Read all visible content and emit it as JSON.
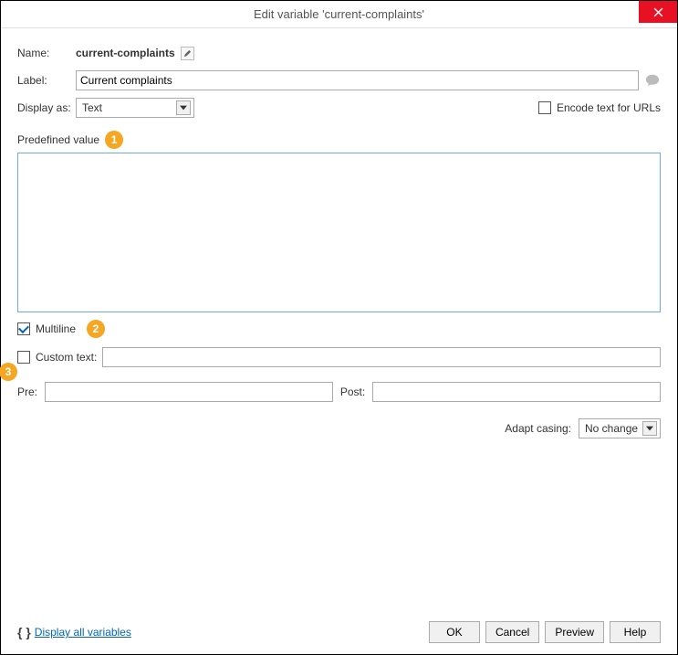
{
  "title": "Edit variable 'current-complaints'",
  "labels": {
    "name": "Name:",
    "label": "Label:",
    "display_as": "Display as:",
    "encode": "Encode text for URLs",
    "predefined": "Predefined value",
    "multiline": "Multiline",
    "custom_text": "Custom text:",
    "pre": "Pre:",
    "post": "Post:",
    "adapt_casing": "Adapt casing:",
    "display_all": "Display all variables"
  },
  "values": {
    "name": "current-complaints",
    "label": "Current complaints",
    "display_as": "Text",
    "encode_checked": false,
    "predefined_value": "",
    "multiline_checked": true,
    "custom_checked": false,
    "custom_text": "",
    "pre": "",
    "post": "",
    "adapt_casing": "No change"
  },
  "buttons": {
    "ok": "OK",
    "cancel": "Cancel",
    "preview": "Preview",
    "help": "Help"
  },
  "annotations": {
    "a1": "1",
    "a2": "2",
    "a3": "3"
  }
}
